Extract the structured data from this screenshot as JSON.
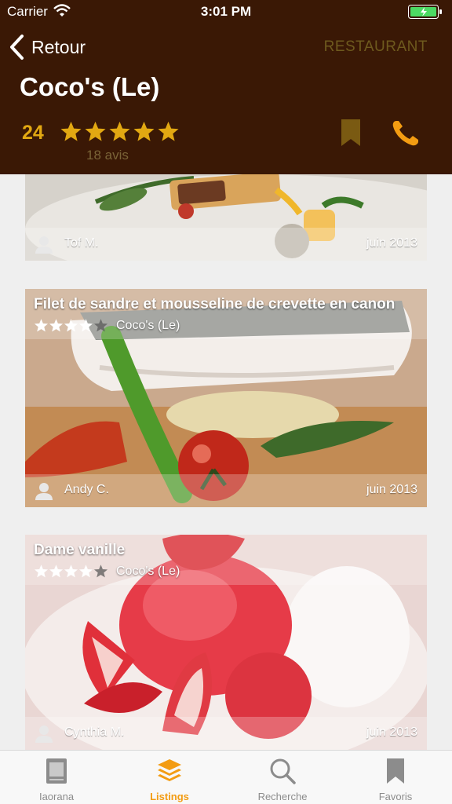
{
  "status_bar": {
    "carrier": "Carrier",
    "time": "3:01 PM"
  },
  "nav": {
    "back_label": "Retour",
    "section_label": "RESTAURANT"
  },
  "place": {
    "name": "Coco's (Le)",
    "score": "24",
    "stars": 5,
    "reviews": "18 avis"
  },
  "colors": {
    "header_bg": "#3a1805",
    "accent": "#f39c12",
    "star_gold": "#e2a812",
    "bookmark": "#7a5a12"
  },
  "cards": [
    {
      "title": "",
      "stars": 0,
      "place": "",
      "author": "Tof M.",
      "date": "juin 2013",
      "photo": "dish-plate"
    },
    {
      "title": "Filet de sandre et mousseline de crevette en canon",
      "stars": 4,
      "place": "Coco's (Le)",
      "author": "Andy C.",
      "date": "juin 2013",
      "photo": "fish-fillet"
    },
    {
      "title": "Dame vanille",
      "stars": 4,
      "place": "Coco's (Le)",
      "author": "Cynthia M.",
      "date": "juin 2013",
      "photo": "strawberry-dessert"
    }
  ],
  "tabbar": {
    "tabs": [
      {
        "label": "Iaorana",
        "icon": "newspaper-icon",
        "active": false
      },
      {
        "label": "Listings",
        "icon": "layers-icon",
        "active": true
      },
      {
        "label": "Recherche",
        "icon": "search-icon",
        "active": false
      },
      {
        "label": "Favoris",
        "icon": "bookmark-icon",
        "active": false
      }
    ]
  }
}
